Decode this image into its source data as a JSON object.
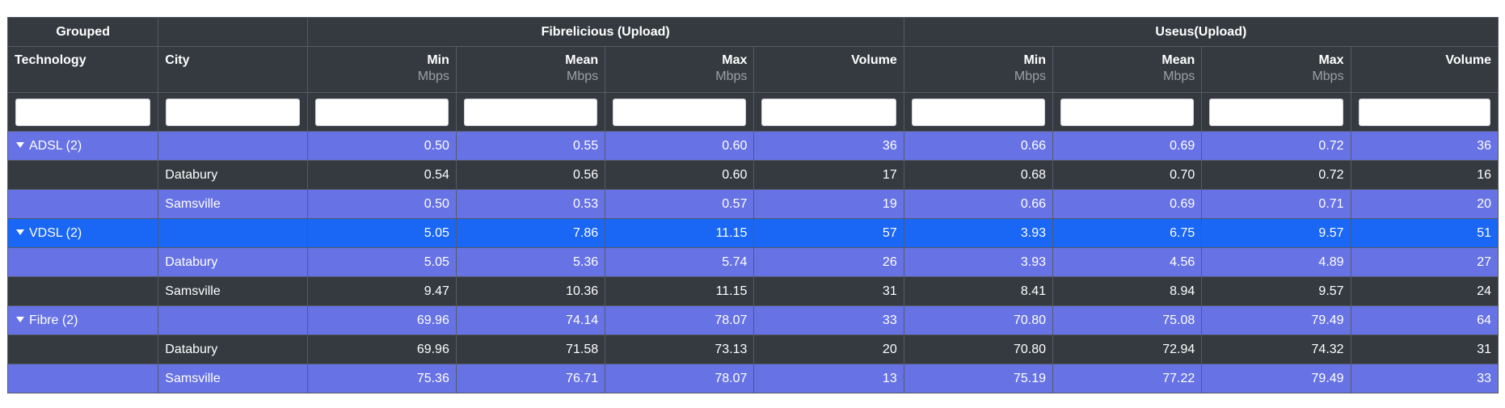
{
  "header": {
    "grouped_label": "Grouped",
    "group1_label": "Fibrelicious (Upload)",
    "group2_label": "Useus(Upload)",
    "col_technology": "Technology",
    "col_city": "City",
    "col_min": "Min",
    "col_mean": "Mean",
    "col_max": "Max",
    "col_volume": "Volume",
    "unit": "Mbps"
  },
  "rows": [
    {
      "tech": "ADSL (2)",
      "city": "",
      "f_min": "0.50",
      "f_mean": "0.55",
      "f_max": "0.60",
      "f_vol": "36",
      "u_min": "0.66",
      "u_mean": "0.69",
      "u_max": "0.72",
      "u_vol": "36"
    },
    {
      "tech": "",
      "city": "Databury",
      "f_min": "0.54",
      "f_mean": "0.56",
      "f_max": "0.60",
      "f_vol": "17",
      "u_min": "0.68",
      "u_mean": "0.70",
      "u_max": "0.72",
      "u_vol": "16"
    },
    {
      "tech": "",
      "city": "Samsville",
      "f_min": "0.50",
      "f_mean": "0.53",
      "f_max": "0.57",
      "f_vol": "19",
      "u_min": "0.66",
      "u_mean": "0.69",
      "u_max": "0.71",
      "u_vol": "20"
    },
    {
      "tech": "VDSL (2)",
      "city": "",
      "f_min": "5.05",
      "f_mean": "7.86",
      "f_max": "11.15",
      "f_vol": "57",
      "u_min": "3.93",
      "u_mean": "6.75",
      "u_max": "9.57",
      "u_vol": "51"
    },
    {
      "tech": "",
      "city": "Databury",
      "f_min": "5.05",
      "f_mean": "5.36",
      "f_max": "5.74",
      "f_vol": "26",
      "u_min": "3.93",
      "u_mean": "4.56",
      "u_max": "4.89",
      "u_vol": "27"
    },
    {
      "tech": "",
      "city": "Samsville",
      "f_min": "9.47",
      "f_mean": "10.36",
      "f_max": "11.15",
      "f_vol": "31",
      "u_min": "8.41",
      "u_mean": "8.94",
      "u_max": "9.57",
      "u_vol": "24"
    },
    {
      "tech": "Fibre (2)",
      "city": "",
      "f_min": "69.96",
      "f_mean": "74.14",
      "f_max": "78.07",
      "f_vol": "33",
      "u_min": "70.80",
      "u_mean": "75.08",
      "u_max": "79.49",
      "u_vol": "64"
    },
    {
      "tech": "",
      "city": "Databury",
      "f_min": "69.96",
      "f_mean": "71.58",
      "f_max": "73.13",
      "f_vol": "20",
      "u_min": "70.80",
      "u_mean": "72.94",
      "u_max": "74.32",
      "u_vol": "31"
    },
    {
      "tech": "",
      "city": "Samsville",
      "f_min": "75.36",
      "f_mean": "76.71",
      "f_max": "78.07",
      "f_vol": "13",
      "u_min": "75.19",
      "u_mean": "77.22",
      "u_max": "79.49",
      "u_vol": "33"
    }
  ],
  "colors": {
    "header_bg": "#343a40",
    "row_purple": "#6772e5",
    "row_dark": "#343a40",
    "row_selected_blue": "#1a66f5"
  }
}
